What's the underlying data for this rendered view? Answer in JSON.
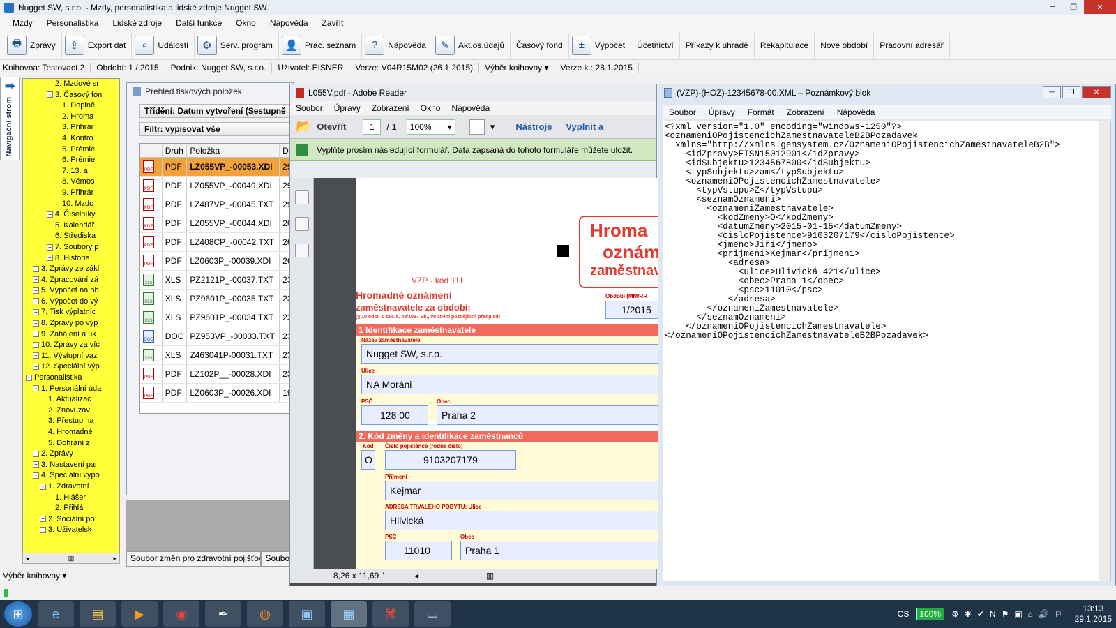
{
  "app": {
    "title": "Nugget SW, s.r.o. - Mzdy, personalistika a lidské zdroje Nugget SW",
    "menu": [
      "Mzdy",
      "Personalistika",
      "Lidské zdroje",
      "Další funkce",
      "Okno",
      "Nápověda",
      "Zavřít"
    ],
    "toolbar": [
      {
        "label": "Zprávy",
        "icon": "printer-icon"
      },
      {
        "label": "Export dat",
        "icon": "export-icon"
      },
      {
        "label": "Události",
        "icon": "magnifier-icon"
      },
      {
        "label": "Serv. program",
        "icon": "gear-icon"
      },
      {
        "label": "Prac. seznam",
        "icon": "worker-icon"
      },
      {
        "label": "Nápověda",
        "icon": "help-icon"
      },
      {
        "label": "Akt.os.údajů",
        "icon": "edit-icon"
      },
      {
        "label": "Časový fond",
        "icon": ""
      },
      {
        "label": "Výpočet",
        "icon": "calculator-icon"
      },
      {
        "label": "Účetnictví",
        "icon": ""
      },
      {
        "label": "Příkazy k úhradě",
        "icon": ""
      },
      {
        "label": "Rekapitulace",
        "icon": ""
      },
      {
        "label": "Nové období",
        "icon": ""
      },
      {
        "label": "Pracovní adresář",
        "icon": ""
      }
    ],
    "status": [
      "Knihovna: Testovací 2",
      "Období: 1 / 2015",
      "Podnik: Nugget SW, s.r.o.",
      "Uživatel: EISNER",
      "Verze: V04R15M02 (26.1.2015)",
      "Výběr knihovny ▾",
      "Verze k.: 28.1.2015"
    ],
    "nav_label": "Navigační strom",
    "library_select": "Výběr knihovny ▾"
  },
  "tree": [
    {
      "indent": 3,
      "exp": "",
      "label": "2. Mzdové sr"
    },
    {
      "indent": 3,
      "exp": "-",
      "label": "3. Časový fon"
    },
    {
      "indent": 4,
      "exp": "",
      "label": "1. Doplně"
    },
    {
      "indent": 4,
      "exp": "",
      "label": "2. Hroma"
    },
    {
      "indent": 4,
      "exp": "",
      "label": "3. Přihrár"
    },
    {
      "indent": 4,
      "exp": "",
      "label": "4. Kontro"
    },
    {
      "indent": 4,
      "exp": "",
      "label": "5. Prémie"
    },
    {
      "indent": 4,
      "exp": "",
      "label": "6. Prémie"
    },
    {
      "indent": 4,
      "exp": "",
      "label": "7. 13. a"
    },
    {
      "indent": 4,
      "exp": "",
      "label": "8. Věmos"
    },
    {
      "indent": 4,
      "exp": "",
      "label": "9. Přihrár"
    },
    {
      "indent": 4,
      "exp": "",
      "label": "10. Mzdc"
    },
    {
      "indent": 3,
      "exp": "+",
      "label": "4. Číselníky"
    },
    {
      "indent": 3,
      "exp": "",
      "label": "5. Kalendář"
    },
    {
      "indent": 3,
      "exp": "",
      "label": "6. Střediska"
    },
    {
      "indent": 3,
      "exp": "+",
      "label": "7. Soubory p"
    },
    {
      "indent": 3,
      "exp": "+",
      "label": "8. Historie"
    },
    {
      "indent": 1,
      "exp": "+",
      "label": "3. Zprávy ze zákl"
    },
    {
      "indent": 1,
      "exp": "+",
      "label": "4. Zpracování zá"
    },
    {
      "indent": 1,
      "exp": "+",
      "label": "5. Výpočet na ob"
    },
    {
      "indent": 1,
      "exp": "+",
      "label": "6. Výpočet do vý"
    },
    {
      "indent": 1,
      "exp": "+",
      "label": "7. Tisk výplatníc"
    },
    {
      "indent": 1,
      "exp": "+",
      "label": "8. Zprávy po výp"
    },
    {
      "indent": 1,
      "exp": "+",
      "label": "9. Zahájení a uk"
    },
    {
      "indent": 1,
      "exp": "+",
      "label": "10. Zprávy za víc"
    },
    {
      "indent": 1,
      "exp": "+",
      "label": "11. Výstupní vaz"
    },
    {
      "indent": 1,
      "exp": "+",
      "label": "12. Speciální výp"
    },
    {
      "indent": 0,
      "exp": "-",
      "label": "Personalistika"
    },
    {
      "indent": 1,
      "exp": "-",
      "label": "1. Personální úda"
    },
    {
      "indent": 2,
      "exp": "",
      "label": "1. Aktualizac"
    },
    {
      "indent": 2,
      "exp": "",
      "label": "2. Znovuzav"
    },
    {
      "indent": 2,
      "exp": "",
      "label": "3. Přestup na"
    },
    {
      "indent": 2,
      "exp": "",
      "label": "4. Hromadné"
    },
    {
      "indent": 2,
      "exp": "",
      "label": "5. Dohrání z"
    },
    {
      "indent": 1,
      "exp": "+",
      "label": "2. Zprávy"
    },
    {
      "indent": 1,
      "exp": "+",
      "label": "3. Nastavení par"
    },
    {
      "indent": 1,
      "exp": "-",
      "label": "4. Speciální výpo"
    },
    {
      "indent": 2,
      "exp": "-",
      "label": "1. Zdravotní"
    },
    {
      "indent": 3,
      "exp": "",
      "label": "1. Hlášer"
    },
    {
      "indent": 3,
      "exp": "",
      "label": "2. Přihlá"
    },
    {
      "indent": 2,
      "exp": "+",
      "label": "2. Sociální po"
    },
    {
      "indent": 2,
      "exp": "+",
      "label": "3. Uživatelsk"
    }
  ],
  "print_panel": {
    "title": "Přehled tiskových položek",
    "sort": "Třídění: Datum vytvoření (Sestupně",
    "filter": "Filtr: vypisovat vše",
    "columns": [
      "",
      "Druh",
      "Položka",
      "Da"
    ],
    "rows": [
      {
        "type": "PDF",
        "item": "LZ055VP_-00053.XDI",
        "d": "29",
        "sel": true
      },
      {
        "type": "PDF",
        "item": "LZ055VP_-00049.XDI",
        "d": "29",
        "sel": false
      },
      {
        "type": "PDF",
        "item": "LZ487VP_-00045.TXT",
        "d": "29",
        "sel": false
      },
      {
        "type": "PDF",
        "item": "LZ055VP_-00044.XDI",
        "d": "26",
        "sel": false
      },
      {
        "type": "PDF",
        "item": "LZ408CP_-00042.TXT",
        "d": "26",
        "sel": false
      },
      {
        "type": "PDF",
        "item": "LZ0603P_-00039.XDI",
        "d": "26",
        "sel": false
      },
      {
        "type": "XLS",
        "item": "PZ2121P_-00037.TXT",
        "d": "23",
        "sel": false
      },
      {
        "type": "XLS",
        "item": "PZ9601P_-00035.TXT",
        "d": "23",
        "sel": false
      },
      {
        "type": "XLS",
        "item": "PZ9601P_-00034.TXT",
        "d": "23",
        "sel": false
      },
      {
        "type": "DOC",
        "item": "PZ953VP_-00033.TXT",
        "d": "23",
        "sel": false
      },
      {
        "type": "XLS",
        "item": "Z463041P-00031.TXT",
        "d": "23",
        "sel": false
      },
      {
        "type": "PDF",
        "item": "LZ102P__-00028.XDI",
        "d": "23",
        "sel": false
      },
      {
        "type": "PDF",
        "item": "LZ0603P_-00026.XDI",
        "d": "19",
        "sel": false
      }
    ],
    "tabs": [
      "Soubor změn pro zdravotní pojišťovnu",
      "Soubor"
    ]
  },
  "adobe": {
    "title": "L055V.pdf - Adobe Reader",
    "menu": [
      "Soubor",
      "Úpravy",
      "Zobrazení",
      "Okno",
      "Nápověda"
    ],
    "open": "Otevřít",
    "page": "1",
    "page_total": "/ 1",
    "zoom": "100%",
    "tools": "Nástroje",
    "fill": "Vyplnit a",
    "notice": "Vyplňte prosím následující formulář. Data zapsaná do tohoto formuláře můžete uložit.",
    "doc_size": "8,26 x 11,69 \"",
    "form": {
      "insurer": "VZP - kód 111",
      "title1": "Hromadné oznámení",
      "title2": "zaměstnavatele za období:",
      "law": "(§ 10 odst. 1 zák. č. 48/1997 Sb., ve znění pozdějších předpisů)",
      "big1": "Hroma",
      "big2": "oznám",
      "big3": "zaměstnava",
      "period_label": "Období (MM/RR",
      "period": "1/2015",
      "sec1": "1  Identifikace zaměstnavatele",
      "name_label": "Název zaměstnavatele",
      "name": "Nugget SW, s.r.o.",
      "street_label": "Ulice",
      "street": "NA Moráni",
      "psc_label": "PSČ",
      "psc": "128 00",
      "city_label": "Obec",
      "city": "Praha 2",
      "sec2": "2. Kód změny a identifikace zaměstnanců",
      "code_label": "Kód",
      "code": "O",
      "ins_label": "Číslo pojištěnce (rodné číslo)",
      "ins": "9103207179",
      "surname_label": "Příjmení",
      "surname": "Kejmar",
      "addr_label": "ADRESA TRVALÉHO POBYTU: Ulice",
      "addr": "Hlivická",
      "psc2_label": "PSČ",
      "psc2": "11010",
      "city2_label": "Obec",
      "city2": "Praha 1"
    }
  },
  "notepad": {
    "title": "(VZP)-(HOZ)-12345678-00.XML – Poznámkový blok",
    "menu": [
      "Soubor",
      "Úpravy",
      "Formát",
      "Zobrazení",
      "Nápověda"
    ],
    "text": "<?xml version=\"1.0\" encoding=\"windows-1250\"?>\n<oznameniOPojistencichZamestnavateleB2BPozadavek\n  xmlns=\"http://xmlns.gemsystem.cz/OznameniOPojistencichZamestnavateleB2B\">\n    <idZpravy>EISN15012901</idZpravy>\n    <idSubjektu>1234567800</idSubjektu>\n    <typSubjektu>zam</typSubjektu>\n    <oznameniOPojistencichZamestnavatele>\n      <typVstupu>Z</typVstupu>\n      <seznamOznameni>\n        <oznameniZamestnavatele>\n          <kodZmeny>O</kodZmeny>\n          <datumZmeny>2015-01-15</datumZmeny>\n          <cisloPojistence>9103207179</cisloPojistence>\n          <jmeno>Jiří</jmeno>\n          <prijmeni>Kejmar</prijmeni>\n            <adresa>\n              <ulice>Hlivická 421</ulice>\n              <obec>Praha 1</obec>\n              <psc>11010</psc>\n            </adresa>\n        </oznameniZamestnavatele>\n      </seznamOznameni>\n    </oznameniOPojistencichZamestnavatele>\n</oznameniOPojistencichZamestnavateleB2BPozadavek>\n"
  },
  "taskbar": {
    "lang": "CS",
    "battery": "100%",
    "time": "13:13",
    "date": "29.1.2015"
  }
}
